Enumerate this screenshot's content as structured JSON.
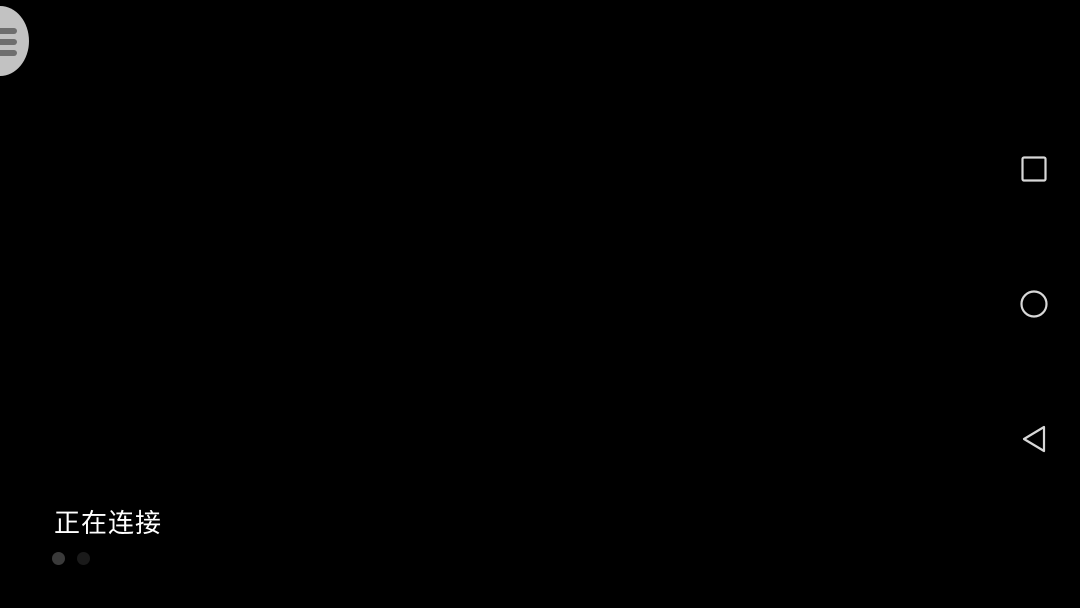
{
  "status": {
    "text": "正在连接"
  },
  "progress": {
    "dot_count": 2,
    "active_dot": 1,
    "active_color": "#3a3a3a",
    "inactive_color": "#1a1a1a"
  },
  "navigation": {
    "buttons": [
      "recents",
      "home",
      "back"
    ]
  },
  "colors": {
    "background": "#000000",
    "menu_button": "#c2c2c2",
    "menu_lines": "#6e6e6e",
    "nav_icon": "#d8d8d8",
    "status_text": "#ffffff"
  }
}
